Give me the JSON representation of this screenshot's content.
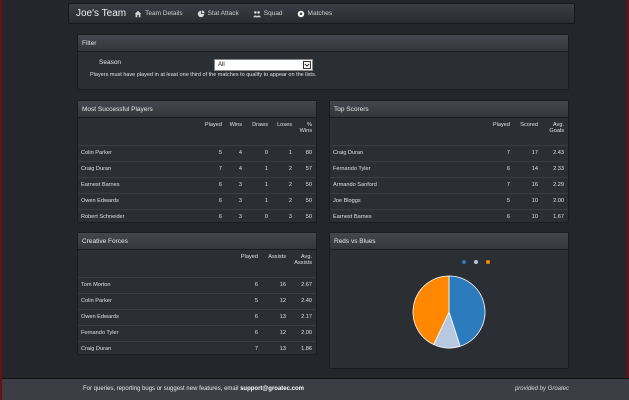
{
  "navbar": {
    "brand": "Joe's Team",
    "items": [
      {
        "label": "Team Details",
        "icon": "home-icon"
      },
      {
        "label": "Stat Attack",
        "icon": "pie-icon"
      },
      {
        "label": "Squad",
        "icon": "users-icon"
      },
      {
        "label": "Matches",
        "icon": "ball-icon"
      }
    ]
  },
  "filter": {
    "title": "Filter",
    "season_label": "Season",
    "season_value": "All",
    "note": "Players must have played in at least one third of the matches to qualify to appear on the lists."
  },
  "most_successful": {
    "title": "Most Successful Players",
    "headers": [
      "Played",
      "Wins",
      "Draws",
      "Loses",
      "% Wins"
    ],
    "rows": [
      {
        "name": "Colin Parker",
        "played": "5",
        "wins": "4",
        "draws": "0",
        "loses": "1",
        "pct": "80"
      },
      {
        "name": "Craig Duran",
        "played": "7",
        "wins": "4",
        "draws": "1",
        "loses": "2",
        "pct": "57"
      },
      {
        "name": "Earnest Barnes",
        "played": "6",
        "wins": "3",
        "draws": "1",
        "loses": "2",
        "pct": "50"
      },
      {
        "name": "Owen Edwards",
        "played": "6",
        "wins": "3",
        "draws": "1",
        "loses": "2",
        "pct": "50"
      },
      {
        "name": "Robert Schneider",
        "played": "6",
        "wins": "3",
        "draws": "0",
        "loses": "3",
        "pct": "50"
      }
    ]
  },
  "top_scorers": {
    "title": "Top Scorers",
    "headers": [
      "Played",
      "Scored",
      "Avg. Goals"
    ],
    "rows": [
      {
        "name": "Craig Duran",
        "played": "7",
        "scored": "17",
        "avg": "2.43"
      },
      {
        "name": "Fernando Tyler",
        "played": "6",
        "scored": "14",
        "avg": "2.33"
      },
      {
        "name": "Armando Sanford",
        "played": "7",
        "scored": "16",
        "avg": "2.29"
      },
      {
        "name": "Joe Bloggs",
        "played": "5",
        "scored": "10",
        "avg": "2.00"
      },
      {
        "name": "Earnest Barnes",
        "played": "6",
        "scored": "10",
        "avg": "1.67"
      }
    ]
  },
  "creative_forces": {
    "title": "Creative Forces",
    "headers": [
      "Played",
      "Assists",
      "Avg. Assists"
    ],
    "rows": [
      {
        "name": "Tom Morton",
        "played": "6",
        "assists": "16",
        "avg": "2.67"
      },
      {
        "name": "Colin Parker",
        "played": "5",
        "assists": "12",
        "avg": "2.40"
      },
      {
        "name": "Owen Edwards",
        "played": "6",
        "assists": "13",
        "avg": "2.17"
      },
      {
        "name": "Fernando Tyler",
        "played": "6",
        "assists": "12",
        "avg": "2.00"
      },
      {
        "name": "Craig Duran",
        "played": "7",
        "assists": "13",
        "avg": "1.86"
      }
    ]
  },
  "reds_vs_blues": {
    "title": "Reds vs Blues",
    "legend_colors": [
      "#2b7bbd",
      "#b8c8e0",
      "#ff8800"
    ],
    "chart_data": {
      "type": "pie",
      "values": [
        45,
        12,
        43
      ],
      "colors": [
        "#2b7bbd",
        "#b8c8e0",
        "#ff8800"
      ]
    }
  },
  "footer": {
    "left_text": "For queries, reporting bugs or suggest new features, email",
    "email": "support@groatec.com",
    "right_text": "provided by Groatec"
  }
}
